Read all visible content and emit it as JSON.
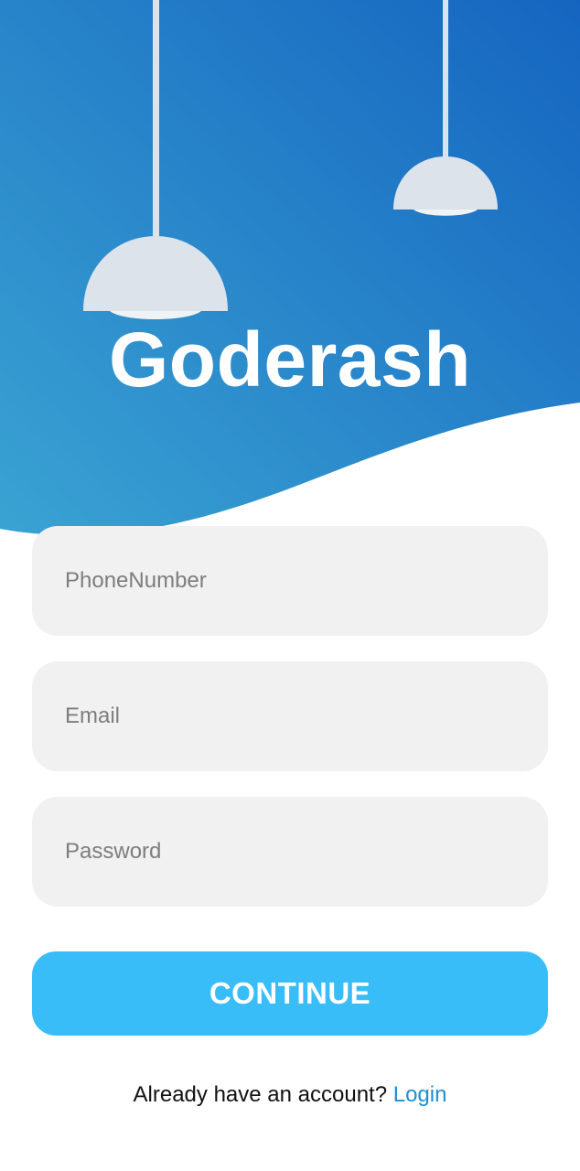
{
  "app": {
    "title": "Goderash"
  },
  "form": {
    "phone_placeholder": "PhoneNumber",
    "email_placeholder": "Email",
    "password_placeholder": "Password",
    "continue_label": "CONTINUE"
  },
  "footer": {
    "prompt": "Already have an account?",
    "login_label": "Login"
  },
  "colors": {
    "header_gradient_start": "#3aa3d3",
    "header_gradient_end": "#1565c0",
    "lamp": "#dde3ea",
    "button": "#39bdf8",
    "field_bg": "#f1f1f1",
    "link": "#1a8fd6"
  },
  "icons": {
    "lamps": [
      "hanging-lamp-icon",
      "hanging-lamp-icon"
    ]
  }
}
